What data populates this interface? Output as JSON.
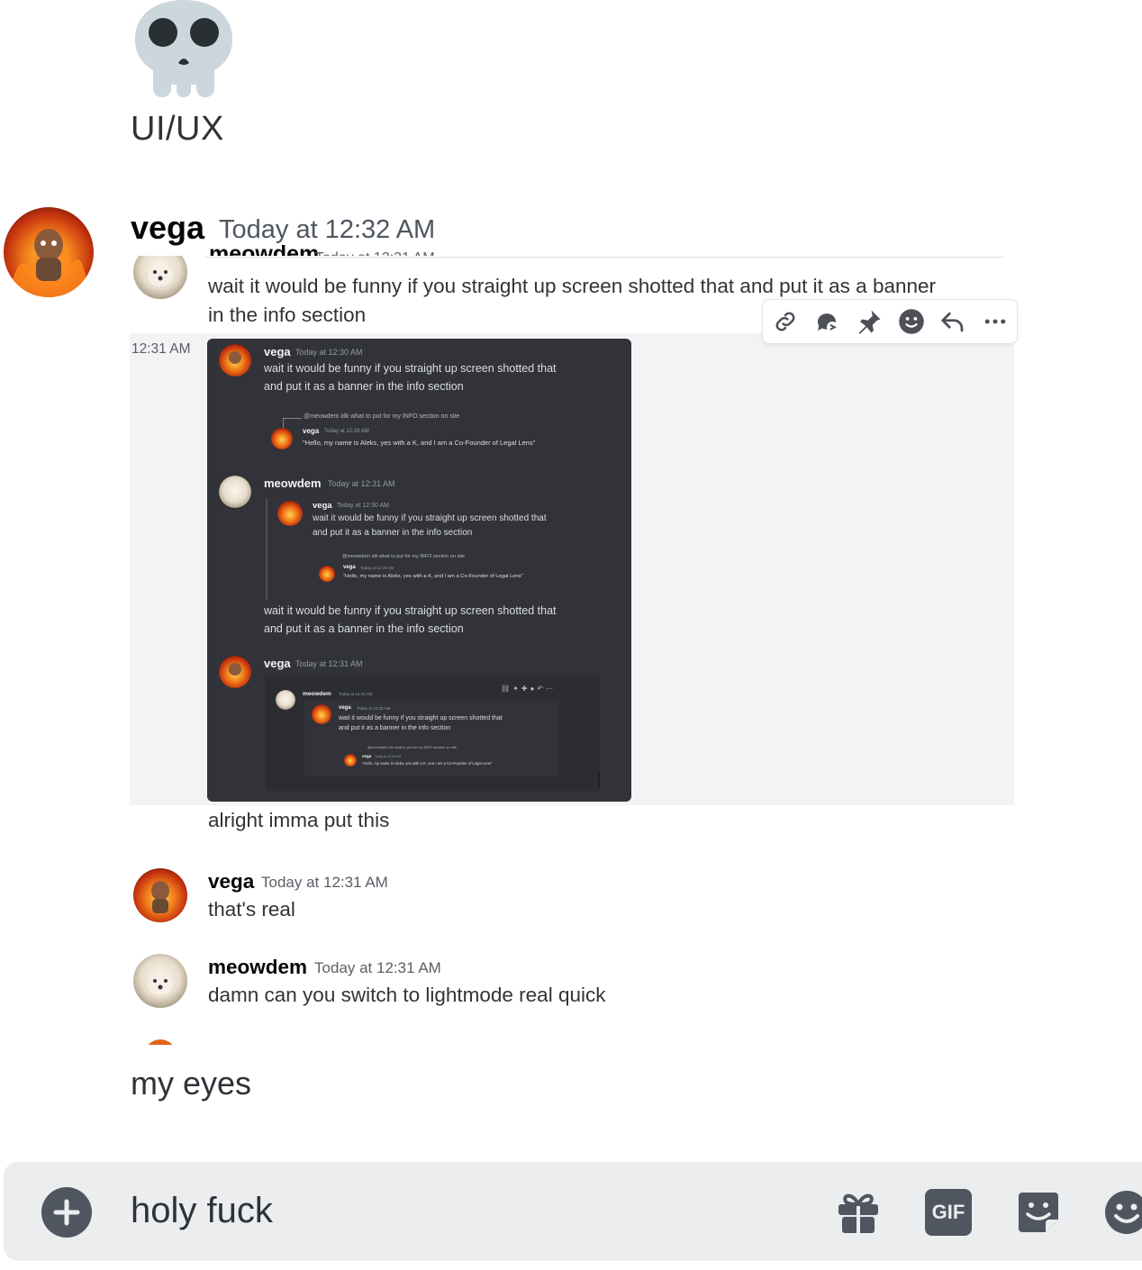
{
  "channel": {
    "title": "UI/UX",
    "icon": "skull-emoji"
  },
  "main_message": {
    "author": "vega",
    "timestamp": "Today at 12:32 AM",
    "caption": "my eyes"
  },
  "screenshot": {
    "cut_header": {
      "author": "meowdem",
      "timestamp": "Today at 12:31 AM"
    },
    "first_message_text": "wait it would be funny if you straight up screen shotted that and put it as a banner in the info section",
    "first_message_line1": "wait it would be funny if you straight up screen shotted that and put it as a banner",
    "first_message_line2": "in the info section",
    "side_timestamp": "12:31 AM",
    "after_image_text": "alright imma put this",
    "toolbar_icons": [
      "link-icon",
      "thread-icon",
      "pin-icon",
      "emoji-icon",
      "reply-icon",
      "more-icon"
    ],
    "messages": [
      {
        "author": "vega",
        "timestamp": "Today at 12:31 AM",
        "text": "that's real"
      },
      {
        "author": "meowdem",
        "timestamp": "Today at 12:31 AM",
        "text": "damn can you switch to lightmode real quick"
      }
    ],
    "dark": {
      "m1_author": "vega",
      "m1_ts": "Today at 12:30 AM",
      "m1_line1": "wait it would be funny if you straight up screen shotted that",
      "m1_line2": "and put it as a banner in the info section",
      "reply_ref": "@meowdem idk what to put for my INFO section on site",
      "r_author": "vega",
      "r_ts": "Today at 12:29 AM",
      "r_text": "\"Hello, my name is Aleks, yes with a K, and I am a Co-Founder of Legal Lens\"",
      "m2_author": "meowdem",
      "m2_ts": "Today at 12:31 AM",
      "q_author": "vega",
      "q_ts": "Today at 12:30 AM",
      "q_line1": "wait it would be funny if you straight up screen shotted that",
      "q_line2": "and put it as a banner in the info section",
      "q_reply_ref": "@meowdem idk what to put for my INFO section on site",
      "q_r_author": "vega",
      "q_r_ts": "Today at 12:29 AM",
      "q_r_text": "\"Hello, my name is Aleks, yes with a K, and I am a Co-Founder of Legal Lens\"",
      "m2_line1": "wait it would be funny if you straight up screen shotted that",
      "m2_line2": "and put it as a banner in the info section",
      "m3_author": "vega",
      "m3_ts": "Today at 12:31 AM",
      "n_author": "meowdem",
      "n_ts": "Today at 12:31 AM",
      "n_q_author": "vega",
      "n_q_ts": "Today at 12:30 AM",
      "n_line1": "wait it would be funny if you straight up screen shotted that",
      "n_line2": "and put it as a banner in the info section",
      "n_reply_ref": "@meowdem idk what to put for my INFO section on site",
      "n_r_author": "vega",
      "n_r_ts": "Today at 12:29 AM",
      "n_r_text": "\"Hello, my name is Aleks, yes with a K, and I am a Co-Founder of Legal Lens\""
    }
  },
  "composer": {
    "text": "holy fuck",
    "icons": [
      "plus-icon",
      "gift-icon",
      "gif-icon",
      "sticker-icon",
      "emoji-icon"
    ],
    "gif_label": "GIF"
  },
  "colors": {
    "background": "#ffffff",
    "composer_bg": "#ebedef",
    "dark_embed": "#313338",
    "text_primary": "#060607",
    "text_muted": "#4f5660",
    "icon": "#4f5660"
  }
}
